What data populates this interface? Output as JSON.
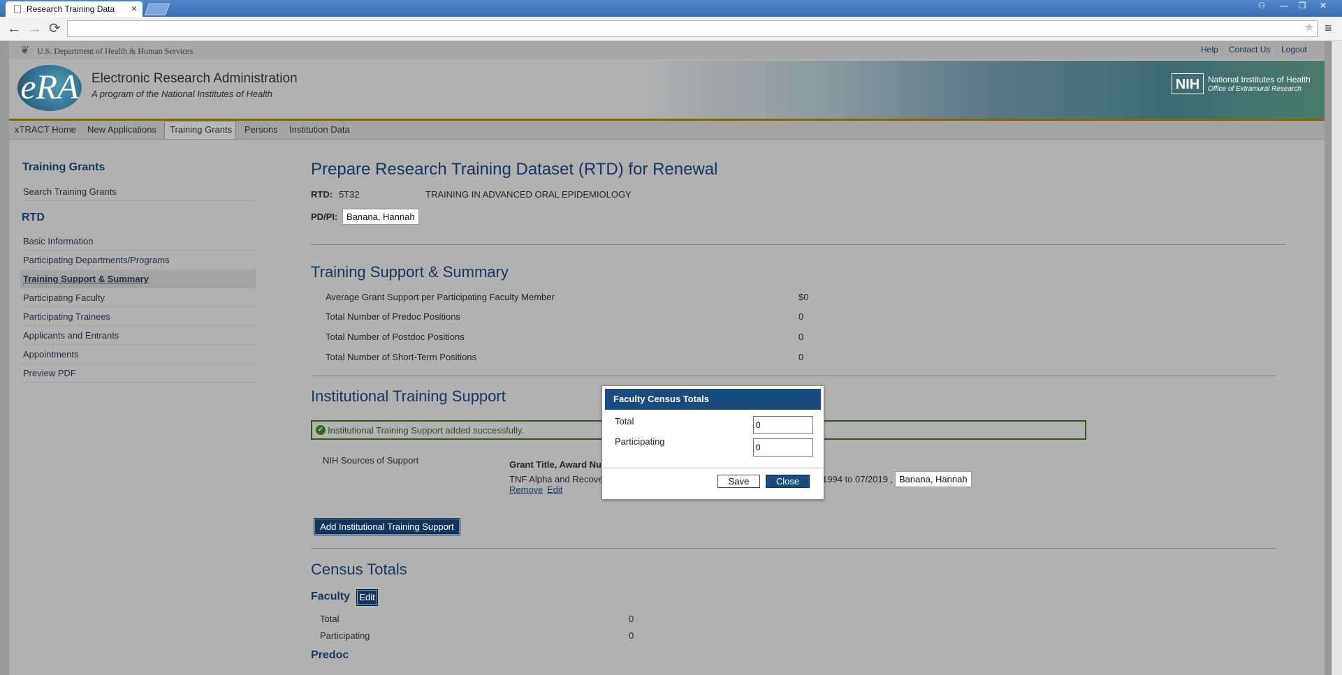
{
  "browser": {
    "tab_title": "Research Training Data",
    "tab_close": "×",
    "back": "←",
    "forward": "→",
    "reload": "⟳",
    "star": "★",
    "menu": "≡",
    "win_user": "⚇",
    "win_min": "—",
    "win_restore": "❐",
    "win_close": "✕",
    "address": ""
  },
  "header": {
    "hhs": "U.S. Department of Health & Human Services",
    "links": [
      "Help",
      "Contact Us",
      "Logout"
    ],
    "era_logo": "eRA",
    "era_title": "Electronic Research Administration",
    "era_subtitle": "A program of the National Institutes of Health",
    "nih_badge": "NIH",
    "nih_name": "National Institutes of Health",
    "nih_office": "Office of Extramural Research",
    "colors": {
      "brand": "#14365e",
      "accent_rule": "#8b6200",
      "success": "#2e5a12"
    }
  },
  "nav": {
    "items": [
      "xTRACT Home",
      "New Applications",
      "Training Grants",
      "Persons",
      "Institution Data"
    ],
    "active": "Training Grants"
  },
  "sidebar": {
    "section1_title": "Training Grants",
    "section1_items": [
      "Search Training Grants"
    ],
    "section2_title": "RTD",
    "section2_items": [
      "Basic Information",
      "Participating Departments/Programs",
      "Training Support & Summary",
      "Participating Faculty",
      "Participating Trainees",
      "Applicants and Entrants",
      "Appointments",
      "Preview PDF"
    ],
    "active_item": "Training Support & Summary"
  },
  "main": {
    "title": "Prepare Research Training Dataset (RTD) for Renewal",
    "rtd_label": "RTD:",
    "rtd_value": "5T32",
    "rtd_title": "TRAINING IN ADVANCED ORAL EPIDEMIOLOGY",
    "pdpi_label": "PD/PI:",
    "pdpi_value": "Banana, Hannah",
    "support_title": "Training Support & Summary",
    "support_rows": [
      {
        "label": "Average Grant Support per Participating Faculty Member",
        "value": "$0"
      },
      {
        "label": "Total Number of Predoc Positions",
        "value": "0"
      },
      {
        "label": "Total Number of Postdoc Positions",
        "value": "0"
      },
      {
        "label": "Total Number of Short-Term Positions",
        "value": "0"
      }
    ],
    "institutional_title": "Institutional Training Support",
    "success_icon": "✓",
    "success_message": "Institutional Training Support added successfully.",
    "nih_sources_label": "NIH Sources of Support",
    "grant_column_header": "Grant Title, Award Nu",
    "grant_entry_start": "TNF Alpha and Recove",
    "grant_entry_end": "1994 to 07/2019 ,",
    "grant_entry_person": "Banana, Hannah",
    "remove_link": "Remove",
    "edit_link": "Edit",
    "add_button": "Add Institutional Training Support",
    "census_title": "Census Totals",
    "faculty_label": "Faculty",
    "faculty_edit": "Edit",
    "faculty_rows": [
      {
        "label": "Total",
        "value": "0"
      },
      {
        "label": "Participating",
        "value": "0"
      }
    ],
    "predoc_label": "Predoc"
  },
  "modal": {
    "title": "Faculty Census Totals",
    "total_label": "Total",
    "total_value": "0",
    "participating_label": "Participating",
    "participating_value": "0",
    "save": "Save",
    "close": "Close"
  }
}
